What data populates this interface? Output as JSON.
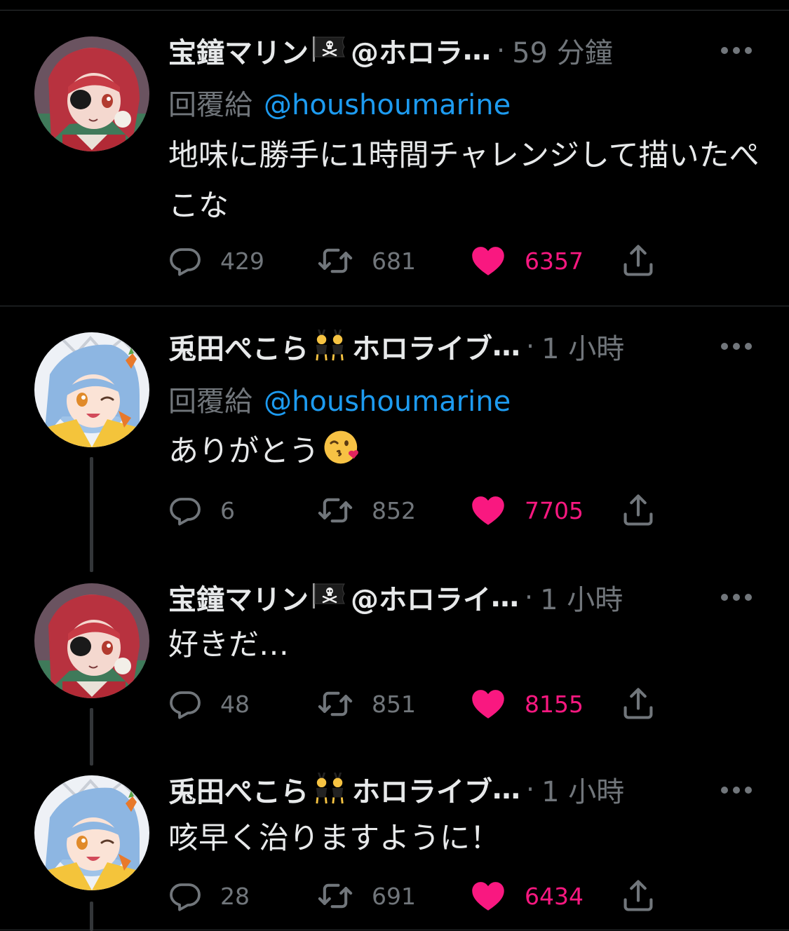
{
  "colors": {
    "background": "#000000",
    "text": "#e7e9ea",
    "secondary": "#71767b",
    "link": "#1d9bf0",
    "like": "#f91880",
    "divider": "#2f3336"
  },
  "tweets": [
    {
      "name": "宝鐘マリン",
      "name_icon": "pirate-flag-icon",
      "handle": "@ホロラ",
      "ellipsis": "…",
      "dot": "·",
      "time": "59 分鐘",
      "reply_prefix": "回覆給",
      "reply_mention": "@houshoumarine",
      "text": "地味に勝手に1時間チャレンジして描いたぺこな",
      "text_emoji": "",
      "replies": "429",
      "retweets": "681",
      "likes": "6357",
      "liked": true,
      "avatar": "marine-avatar"
    },
    {
      "name": "兎田ぺこら",
      "name_icon": "bunny-girls-emoji-icon",
      "handle": "ホロライブ",
      "ellipsis": "…",
      "dot": "·",
      "time": "1 小時",
      "reply_prefix": "回覆給",
      "reply_mention": "@houshoumarine",
      "text": "ありがとう",
      "text_emoji": "kissing-face-emoji-icon",
      "replies": "6",
      "retweets": "852",
      "likes": "7705",
      "liked": true,
      "avatar": "pekora-avatar"
    },
    {
      "name": "宝鐘マリン",
      "name_icon": "pirate-flag-icon",
      "handle": "@ホロライ",
      "ellipsis": "…",
      "dot": "·",
      "time": "1 小時",
      "text": "好きだ…",
      "replies": "48",
      "retweets": "851",
      "likes": "8155",
      "liked": true,
      "avatar": "marine-avatar"
    },
    {
      "name": "兎田ぺこら",
      "name_icon": "bunny-girls-emoji-icon",
      "handle": "ホロライブ",
      "ellipsis": "…",
      "dot": "·",
      "time": "1 小時",
      "text": "咳早く治りますように！",
      "replies": "28",
      "retweets": "691",
      "likes": "6434",
      "liked": true,
      "avatar": "pekora-avatar"
    }
  ]
}
